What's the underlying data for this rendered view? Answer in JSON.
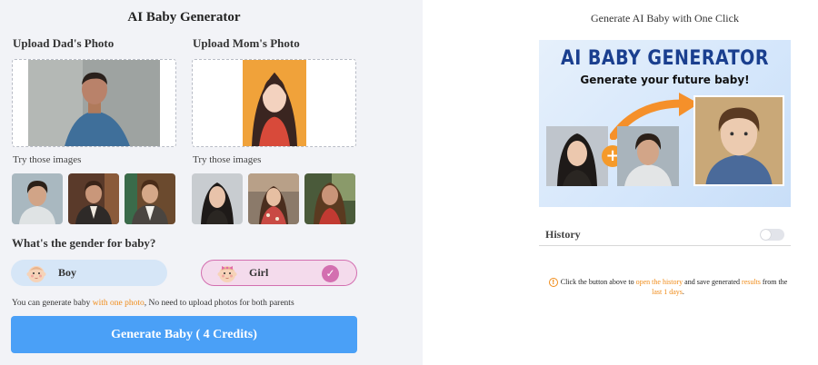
{
  "app": {
    "title": "AI Baby Generator"
  },
  "upload": {
    "dad_label": "Upload Dad's Photo",
    "mom_label": "Upload Mom's Photo",
    "try_label_dad": "Try those images",
    "try_label_mom": "Try those images"
  },
  "gender": {
    "question": "What's the gender for baby?",
    "boy_label": "Boy",
    "girl_label": "Girl",
    "selected": "Girl",
    "check_glyph": "✓"
  },
  "note": {
    "prefix": "You can generate baby ",
    "highlight": "with one photo",
    "suffix": ", No need to upload photos for both parents"
  },
  "generate_button": "Generate Baby ( 4 Credits)",
  "right": {
    "title": "Generate AI Baby with One Click",
    "banner_title": "AI BABY GENERATOR",
    "banner_subtitle": "Generate your future baby!",
    "banner_plus": "+"
  },
  "history": {
    "label": "History",
    "toggle_on": false,
    "info_icon": "!",
    "info_1": "Click the button above to ",
    "info_link_1": "open the history",
    "info_2": " and save generated ",
    "info_link_2": "results",
    "info_3": " from the ",
    "info_link_3": "last 1 days",
    "info_4": "."
  },
  "colors": {
    "accent_blue": "#4aa0f7",
    "accent_orange": "#f08c1a",
    "girl_pink": "#d36fb0",
    "boy_blue": "#d6e6f7",
    "banner_navy": "#1a3f8f"
  }
}
